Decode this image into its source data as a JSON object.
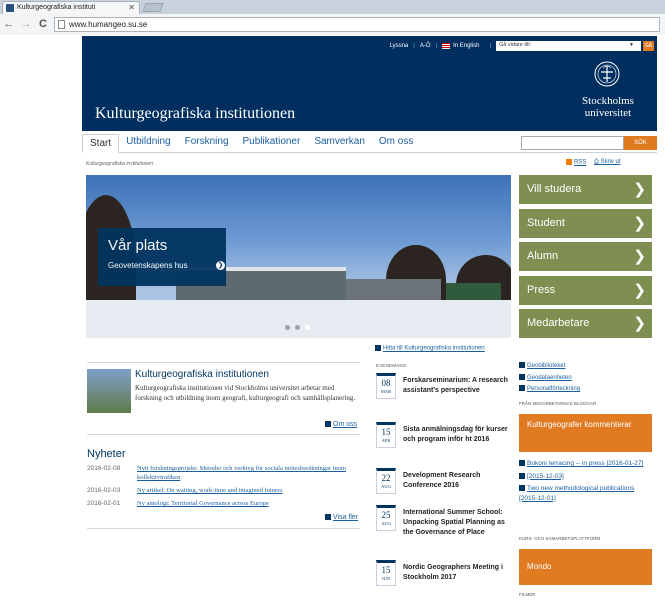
{
  "browser": {
    "tab_title": "Kulturgeografiska instituti",
    "tab_close": "✕",
    "url": "www.humangeo.su.se",
    "back": "←",
    "forward": "→",
    "reload": "C"
  },
  "header": {
    "toplinks": [
      "Lyssna",
      "|",
      "A-Ö",
      "|",
      "In English",
      "|"
    ],
    "goto_placeholder": "Gå vidare till:",
    "goto_arrow": "▼",
    "go_button": "GÅ",
    "site_title": "Kulturgeografiska institutionen",
    "logo_line1": "Stockholms",
    "logo_line2": "universitet"
  },
  "mainnav": [
    "Start",
    "Utbildning",
    "Forskning",
    "Publikationer",
    "Samverkan",
    "Om oss"
  ],
  "search": {
    "button": "SÖK"
  },
  "breadcrumb": "Kulturgeografiska institutionen",
  "tools": {
    "rss": "RSS",
    "print": "Skriv ut"
  },
  "hero": {
    "title": "Vår plats",
    "subtitle": "Geovetenskapens hus",
    "arrow": "❯"
  },
  "sidebar": [
    {
      "label": "Vill studera",
      "arrow": "❯"
    },
    {
      "label": "Student",
      "arrow": "❯"
    },
    {
      "label": "Alumn",
      "arrow": "❯"
    },
    {
      "label": "Press",
      "arrow": "❯"
    },
    {
      "label": "Medarbetare",
      "arrow": "❯"
    }
  ],
  "maplink": "Hitta till Kulturgeografiska institutionen",
  "intro": {
    "title": "Kulturgeografiska institutionen",
    "text": "Kulturgeografiska institutionen vid Stockholms universitet arbetar med forskning och utbildning inom geografi, kulturgeografi och samhällsplanering.",
    "more": "Om oss"
  },
  "news": {
    "heading": "Nyheter",
    "items": [
      {
        "date": "2016-02-08",
        "title": "Nytt forskningsprojekt: Metoder och verktyg för sociala mötesberäkningar inom kollektivtrafiken"
      },
      {
        "date": "2016-02-03",
        "title": "Ny artikel: On waiting, work-time and imagined futures"
      },
      {
        "date": "2016-02-01",
        "title": "Ny antologi: Territorial Governance across Europe"
      }
    ],
    "more": "Visa fler"
  },
  "events": {
    "label": "EVENEMANG",
    "items": [
      {
        "day": "08",
        "month": "MAR",
        "title": "Forskarseminarium: A research assistant's perspective"
      },
      {
        "day": "15",
        "month": "APR",
        "title": "Sista anmälningsdag för kurser och program inför ht 2016"
      },
      {
        "day": "22",
        "month": "AUG",
        "title": "Development Research Conference 2016"
      },
      {
        "day": "25",
        "month": "AUG",
        "title": "International Summer School: Unpacking Spatial Planning as the Governance of Place"
      },
      {
        "day": "15",
        "month": "JUN",
        "title": "Nordic Geographers Meeting i Stockholm 2017"
      }
    ]
  },
  "rightlinks": [
    "Geobiblioteket",
    "Geodataenheten",
    "Personalförteckning"
  ],
  "blogs": {
    "label": "FRÅN MEDARBETARNAS BLOGGAR",
    "box": "Kulturgeografer kommenterar",
    "posts": [
      "Bokoni terracing -- in press [2016-01-27]",
      "[2015-12-03]",
      "Two new methodological publications [2015-12-01]"
    ]
  },
  "kurs": {
    "label": "KURS- OCH SAMARBETSPLATTFORM",
    "box": "Mondo"
  },
  "filmer_label": "FILMER",
  "colors": {
    "brand": "#002e5f",
    "accent": "#e07b22",
    "sidebar": "#7e8f51",
    "link": "#1a5e9e"
  }
}
